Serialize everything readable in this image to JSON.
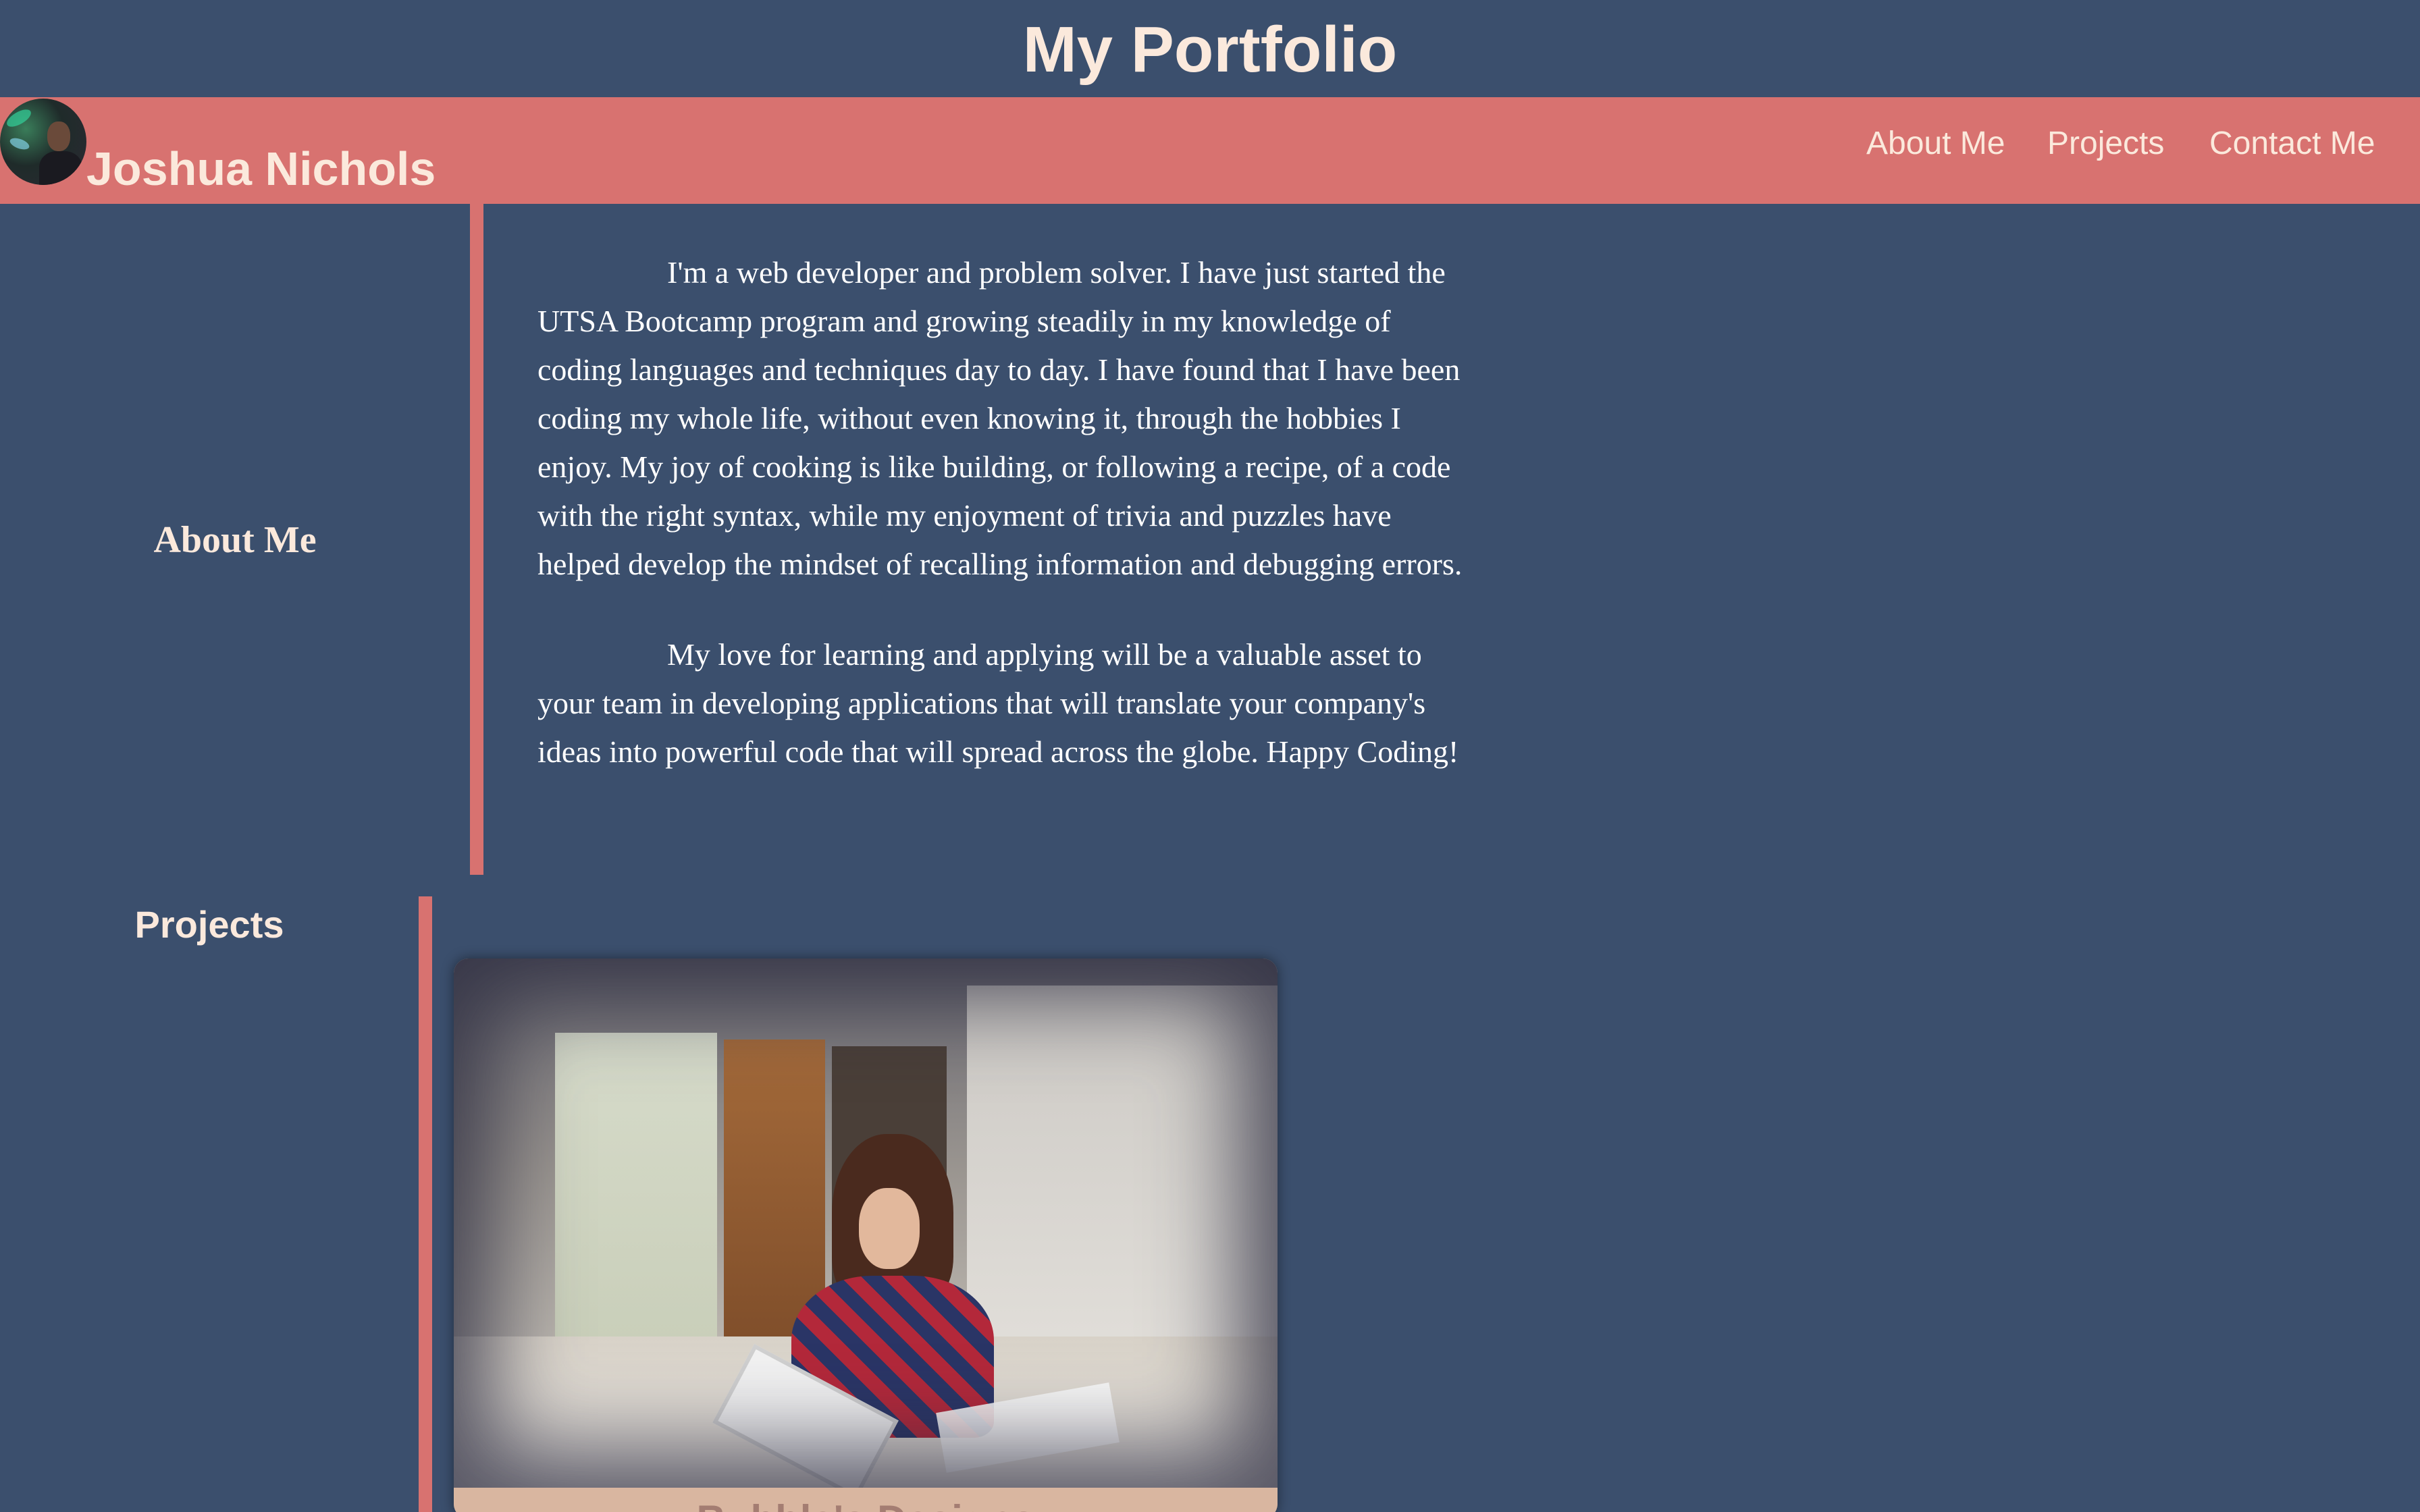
{
  "header": {
    "title": "My Portfolio"
  },
  "navbar": {
    "owner_name": "Joshua Nichols",
    "avatar_alt": "Profile photo",
    "links": [
      {
        "label": "About Me"
      },
      {
        "label": "Projects"
      },
      {
        "label": "Contact Me"
      }
    ]
  },
  "about": {
    "heading": "About Me",
    "paragraphs": [
      "I'm a web developer and problem solver. I have just started the UTSA Bootcamp program and growing steadily in my knowledge of coding languages and techniques day to day. I have found that I have been coding my whole life, without even knowing it, through the hobbies I enjoy. My joy of cooking is like building, or following a recipe, of a code with the right syntax, while my enjoyment of trivia and puzzles have helped develop the mindset of recalling information and debugging errors.",
      "My love for learning and applying will be a valuable asset to your team in developing applications that will translate your company's ideas into powerful code that will spread across the globe. Happy Coding!"
    ]
  },
  "projects": {
    "heading": "Projects",
    "cards": [
      {
        "title": "Bubble's Designs",
        "image": "woman-reading-tablet-in-workshop"
      }
    ]
  },
  "colors": {
    "background": "#3b4f6d",
    "accent": "#d87270",
    "heading_text": "#fbe9dc",
    "body_text": "#ffffff"
  }
}
